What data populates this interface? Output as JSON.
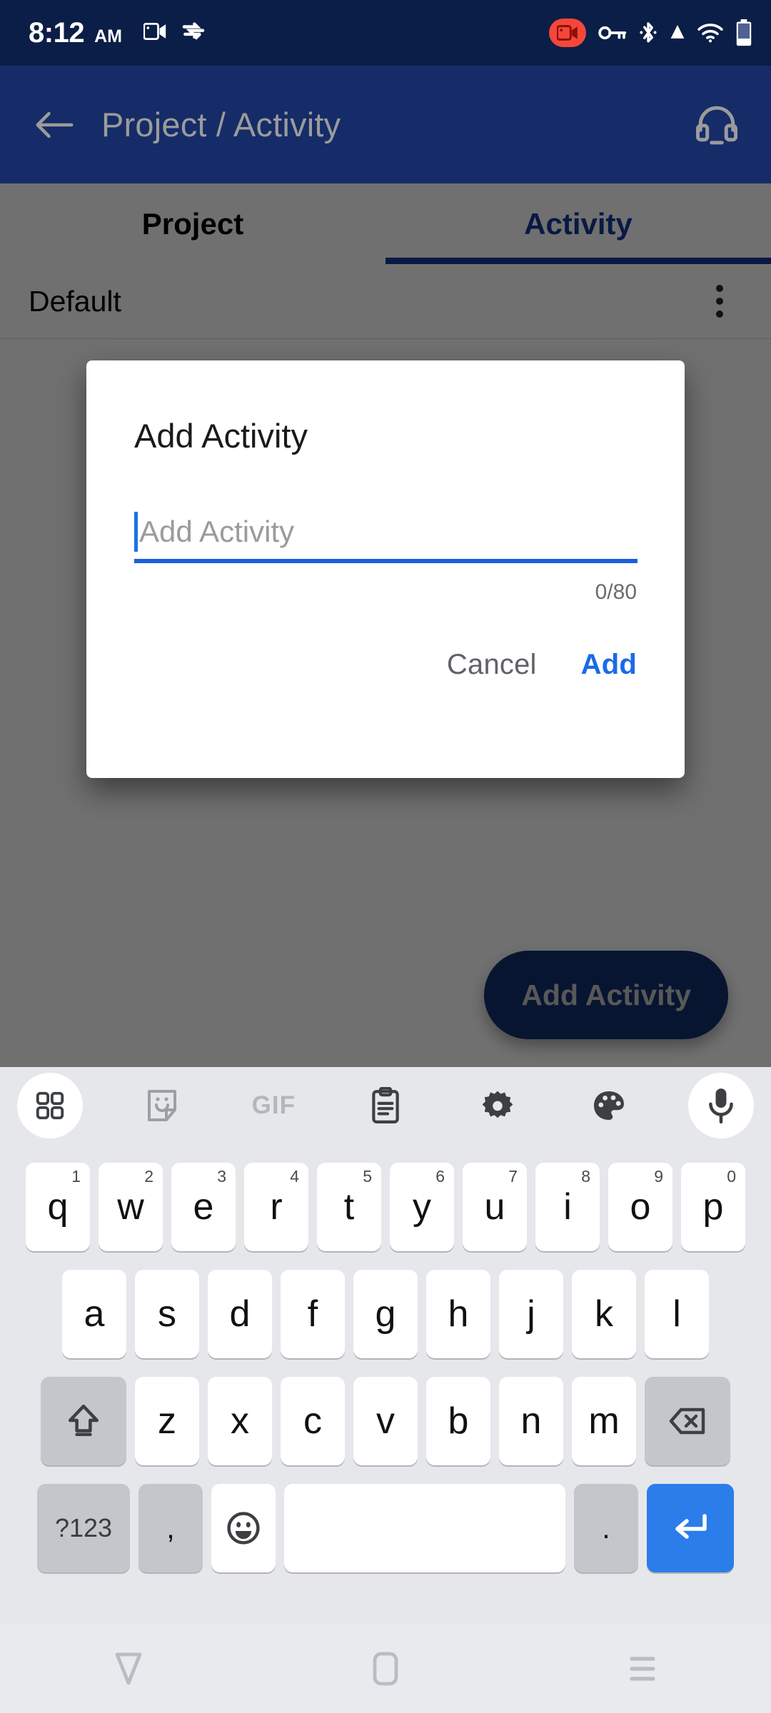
{
  "status_bar": {
    "time": "8:12",
    "ampm": "AM",
    "icons_left": [
      "video-camera-icon",
      "vpn-sync-icon"
    ],
    "icons_right": [
      "screen-record-icon",
      "vpn-key-icon",
      "bluetooth-icon",
      "signal-icon",
      "wifi-icon",
      "battery-icon"
    ],
    "background": "#0b1e47"
  },
  "app_bar": {
    "back_icon": "arrow-back-icon",
    "title": "Project / Activity",
    "action_icon": "headset-icon",
    "background": "#152c68",
    "title_color": "#9b9b9b"
  },
  "tabs": [
    {
      "label": "Project",
      "active": false
    },
    {
      "label": "Activity",
      "active": true
    }
  ],
  "tab_accent": "#13399b",
  "list": {
    "rows": [
      {
        "label": "Default",
        "menu_icon": "more-vert-icon"
      }
    ]
  },
  "fab": {
    "label": "Add Activity",
    "background": "#143070",
    "text_color": "#c9c9c9"
  },
  "dialog": {
    "title": "Add Activity",
    "input_value": "",
    "input_placeholder": "Add Activity",
    "counter": "0/80",
    "cancel_label": "Cancel",
    "add_label": "Add",
    "accent": "#1a6ae8",
    "cancel_color": "#5f6368"
  },
  "keyboard": {
    "background": "#e6e7eb",
    "toolbar": [
      {
        "name": "apps-grid-icon",
        "filled": true
      },
      {
        "name": "sticker-icon",
        "filled": false
      },
      {
        "name": "gif-icon",
        "filled": false,
        "text": "GIF"
      },
      {
        "name": "clipboard-icon",
        "filled": false
      },
      {
        "name": "settings-gear-icon",
        "filled": false
      },
      {
        "name": "palette-icon",
        "filled": false
      },
      {
        "name": "microphone-icon",
        "filled": true
      }
    ],
    "row1": [
      {
        "key": "q",
        "sup": "1"
      },
      {
        "key": "w",
        "sup": "2"
      },
      {
        "key": "e",
        "sup": "3"
      },
      {
        "key": "r",
        "sup": "4"
      },
      {
        "key": "t",
        "sup": "5"
      },
      {
        "key": "y",
        "sup": "6"
      },
      {
        "key": "u",
        "sup": "7"
      },
      {
        "key": "i",
        "sup": "8"
      },
      {
        "key": "o",
        "sup": "9"
      },
      {
        "key": "p",
        "sup": "0"
      }
    ],
    "row2": [
      {
        "key": "a"
      },
      {
        "key": "s"
      },
      {
        "key": "d"
      },
      {
        "key": "f"
      },
      {
        "key": "g"
      },
      {
        "key": "h"
      },
      {
        "key": "j"
      },
      {
        "key": "k"
      },
      {
        "key": "l"
      }
    ],
    "row3": [
      {
        "key": "z"
      },
      {
        "key": "x"
      },
      {
        "key": "c"
      },
      {
        "key": "v"
      },
      {
        "key": "b"
      },
      {
        "key": "n"
      },
      {
        "key": "m"
      }
    ],
    "shift_icon": "shift-arrow-icon",
    "backspace_icon": "backspace-icon",
    "symbols_label": "?123",
    "comma_label": ",",
    "emoji_icon": "emoji-smiley-icon",
    "space_label": "",
    "period_label": ".",
    "enter_icon": "enter-return-icon",
    "enter_background": "#2b7de9"
  },
  "nav_bar": {
    "background": "#e9eaee",
    "buttons": [
      "nav-back-icon",
      "nav-home-icon",
      "nav-recents-icon"
    ]
  }
}
